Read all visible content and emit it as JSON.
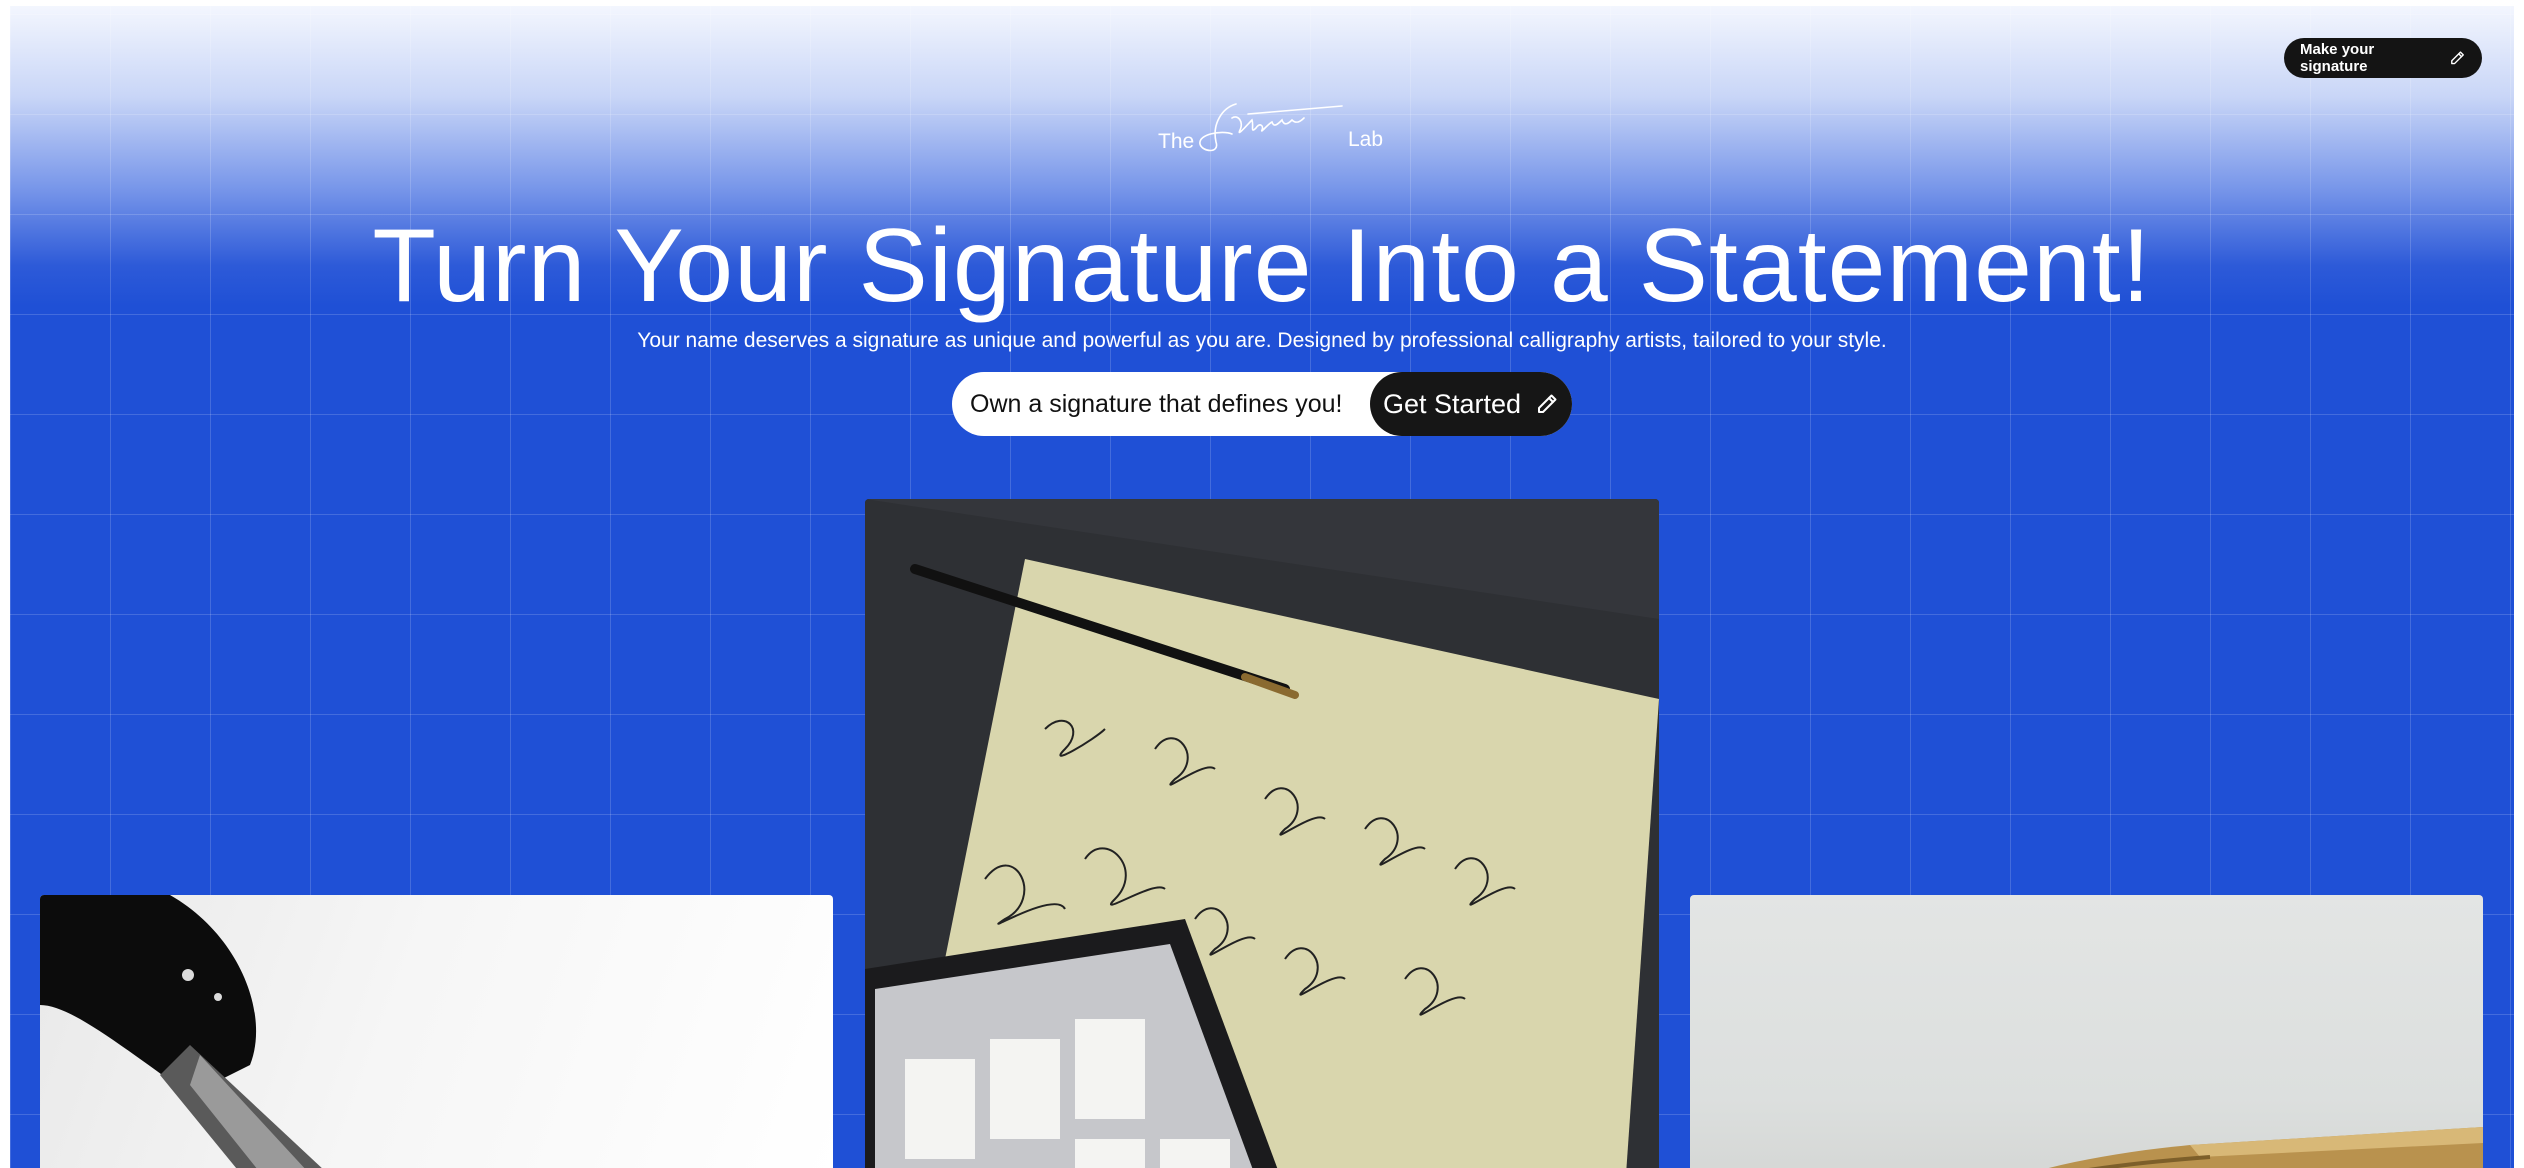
{
  "header": {
    "cta_label": "Make your signature",
    "logo": {
      "prefix": "The",
      "script": "Signature",
      "suffix": "Lab"
    }
  },
  "hero": {
    "title": "Turn Your Signature Into a Statement!",
    "subtitle": "Your name deserves a signature as unique and powerful as you are. Designed by professional calligraphy artists, tailored to your style.",
    "input_placeholder": "Own a signature that defines you!",
    "button_label": "Get Started"
  },
  "gallery": {
    "images": [
      {
        "subject": "fountain pen nib close-up, black and white"
      },
      {
        "subject": "signature sketches on paper with pen and tablet"
      },
      {
        "subject": "gold fountain pen on light grey background"
      }
    ]
  },
  "colors": {
    "brand_blue": "#1f50d6",
    "button_dark": "#141414"
  },
  "icons": {
    "pencil": "pencil-icon"
  }
}
